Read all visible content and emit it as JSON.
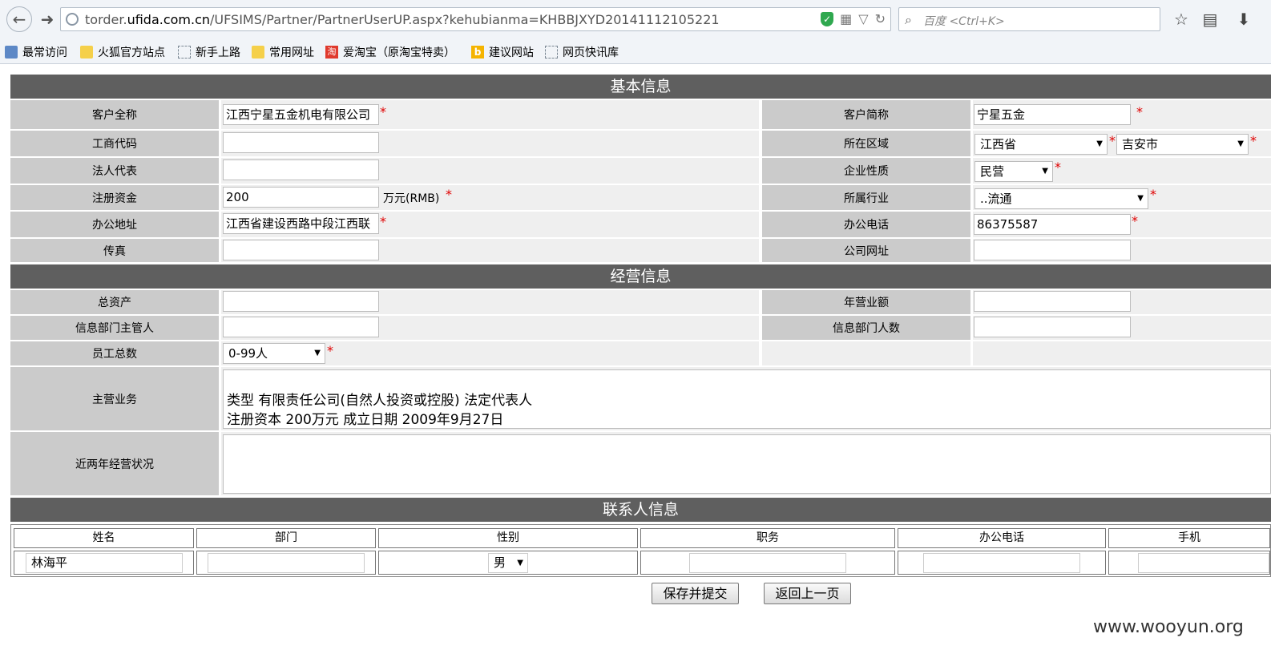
{
  "browser": {
    "url_host": "torder.ufida.com.cn",
    "url_path": "/UFSIMS/Partner/PartnerUserUP.aspx?kehubianma=KHBBJXYD20141112105221",
    "url_prefix": "torder.",
    "url_domain": "ufida.com.cn",
    "search_placeholder": "百度 <Ctrl+K>"
  },
  "bookmarks": [
    "最常访问",
    "火狐官方站点",
    "新手上路",
    "常用网址",
    "爱淘宝（原淘宝特卖）",
    "建议网站",
    "网页快讯库"
  ],
  "sections": {
    "basic": "基本信息",
    "business": "经营信息",
    "contacts": "联系人信息"
  },
  "basic": {
    "full_name_label": "客户全称",
    "full_name_value": "江西宁星五金机电有限公司",
    "short_name_label": "客户简称",
    "short_name_value": "宁星五金",
    "biz_code_label": "工商代码",
    "biz_code_value": "",
    "region_label": "所在区域",
    "province_value": "江西省",
    "city_value": "吉安市",
    "legal_rep_label": "法人代表",
    "legal_rep_value": "",
    "nature_label": "企业性质",
    "nature_value": "民营",
    "capital_label": "注册资金",
    "capital_value": "200",
    "capital_unit": "万元(RMB)",
    "industry_label": "所属行业",
    "industry_value": "..流通",
    "address_label": "办公地址",
    "address_value": "江西省建设西路中段江西联",
    "phone_label": "办公电话",
    "phone_value": "86375587",
    "fax_label": "传真",
    "fax_value": "",
    "website_label": "公司网址",
    "website_value": ""
  },
  "business": {
    "assets_label": "总资产",
    "assets_value": "",
    "revenue_label": "年营业额",
    "revenue_value": "",
    "it_head_label": "信息部门主管人",
    "it_head_value": "",
    "it_count_label": "信息部门人数",
    "it_count_value": "",
    "staff_label": "员工总数",
    "staff_value": "0-99人",
    "main_biz_label": "主营业务",
    "main_biz_line1": "类型 有限责任公司(自然人投资或控股) 法定代表人",
    "main_biz_line2": "注册资本 200万元 成立日期 2009年9月27日",
    "status_label": "近两年经营状况",
    "status_value": ""
  },
  "contacts": {
    "headers": [
      "姓名",
      "部门",
      "性别",
      "职务",
      "办公电话",
      "手机"
    ],
    "row": {
      "name": "林海平",
      "dept": "",
      "gender": "男",
      "title": "",
      "phone": "",
      "mobile": ""
    }
  },
  "buttons": {
    "save": "保存并提交",
    "back": "返回上一页"
  },
  "required_mark": "*",
  "watermark": "www.wooyun.org"
}
